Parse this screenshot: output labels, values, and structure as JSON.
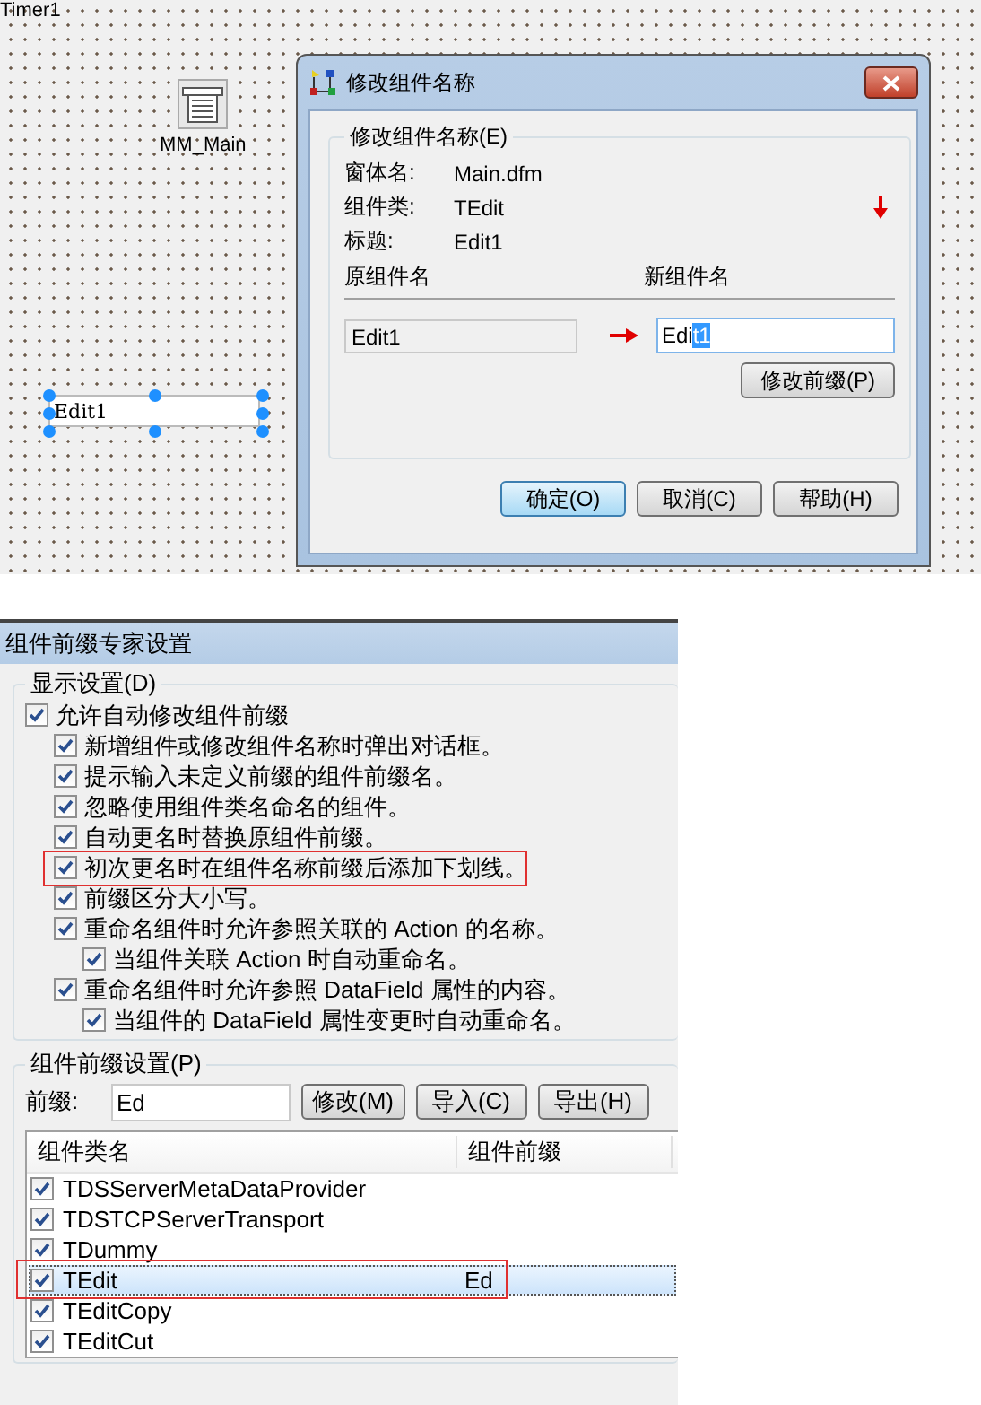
{
  "designer": {
    "caption": "Timer1",
    "components": [
      {
        "kind": "icon",
        "label": "MM_Main"
      },
      {
        "kind": "edit",
        "label": "Edit1",
        "selected": true
      }
    ]
  },
  "rename_dialog": {
    "title": "修改组件名称",
    "group_title": "修改组件名称(E)",
    "info": [
      {
        "label": "窗体名:",
        "value": "Main.dfm"
      },
      {
        "label": "组件类:",
        "value": "TEdit"
      },
      {
        "label": "标题:",
        "value": "Edit1"
      }
    ],
    "old_header": "原组件名",
    "new_header": "新组件名",
    "old_name": "Edit1",
    "new_name": {
      "text": "Edi",
      "selected_text": "t1"
    },
    "prefix_button": "修改前缀(P)",
    "buttons": [
      {
        "label": "确定(O)",
        "default": true
      },
      {
        "label": "取消(C)",
        "default": false
      },
      {
        "label": "帮助(H)",
        "default": false
      }
    ]
  },
  "prefix_settings": {
    "title": "组件前缀专家设置",
    "display_group": "显示设置(D)",
    "options": [
      {
        "label": "允许自动修改组件前缀",
        "checked": true,
        "children": [
          {
            "label": "新增组件或修改组件名称时弹出对话框。",
            "checked": true
          },
          {
            "label": "提示输入未定义前缀的组件前缀名。",
            "checked": true
          },
          {
            "label": "忽略使用组件类名命名的组件。",
            "checked": true
          },
          {
            "label": "自动更名时替换原组件前缀。",
            "checked": true
          },
          {
            "label": "初次更名时在组件名称前缀后添加下划线。",
            "checked": true,
            "annotated": true
          },
          {
            "label": "前缀区分大小写。",
            "checked": true
          },
          {
            "label": "重命名组件时允许参照关联的 Action 的名称。",
            "checked": true,
            "children": [
              {
                "label": "当组件关联 Action 时自动重命名。",
                "checked": true
              }
            ]
          },
          {
            "label": "重命名组件时允许参照 DataField 属性的内容。",
            "checked": true,
            "children": [
              {
                "label": "当组件的 DataField 属性变更时自动重命名。",
                "checked": true
              }
            ]
          }
        ]
      }
    ],
    "prefix_group": "组件前缀设置(P)",
    "prefix_label": "前缀:",
    "prefix_value": "Ed",
    "buttons": [
      "修改(M)",
      "导入(C)",
      "导出(H)"
    ],
    "columns": [
      "组件类名",
      "组件前缀"
    ],
    "rows": [
      {
        "name": "TDSServerMetaDataProvider",
        "checked": true,
        "selected": false
      },
      {
        "name": "TDSTCPServerTransport",
        "checked": true,
        "selected": false
      },
      {
        "name": "TDummy",
        "checked": true,
        "selected": false
      },
      {
        "name": "TEdit",
        "prefix": "Ed",
        "checked": true,
        "selected": true,
        "annotated": true
      },
      {
        "name": "TEditCopy",
        "checked": true,
        "selected": false
      },
      {
        "name": "TEditCut",
        "checked": true,
        "selected": false
      }
    ]
  }
}
